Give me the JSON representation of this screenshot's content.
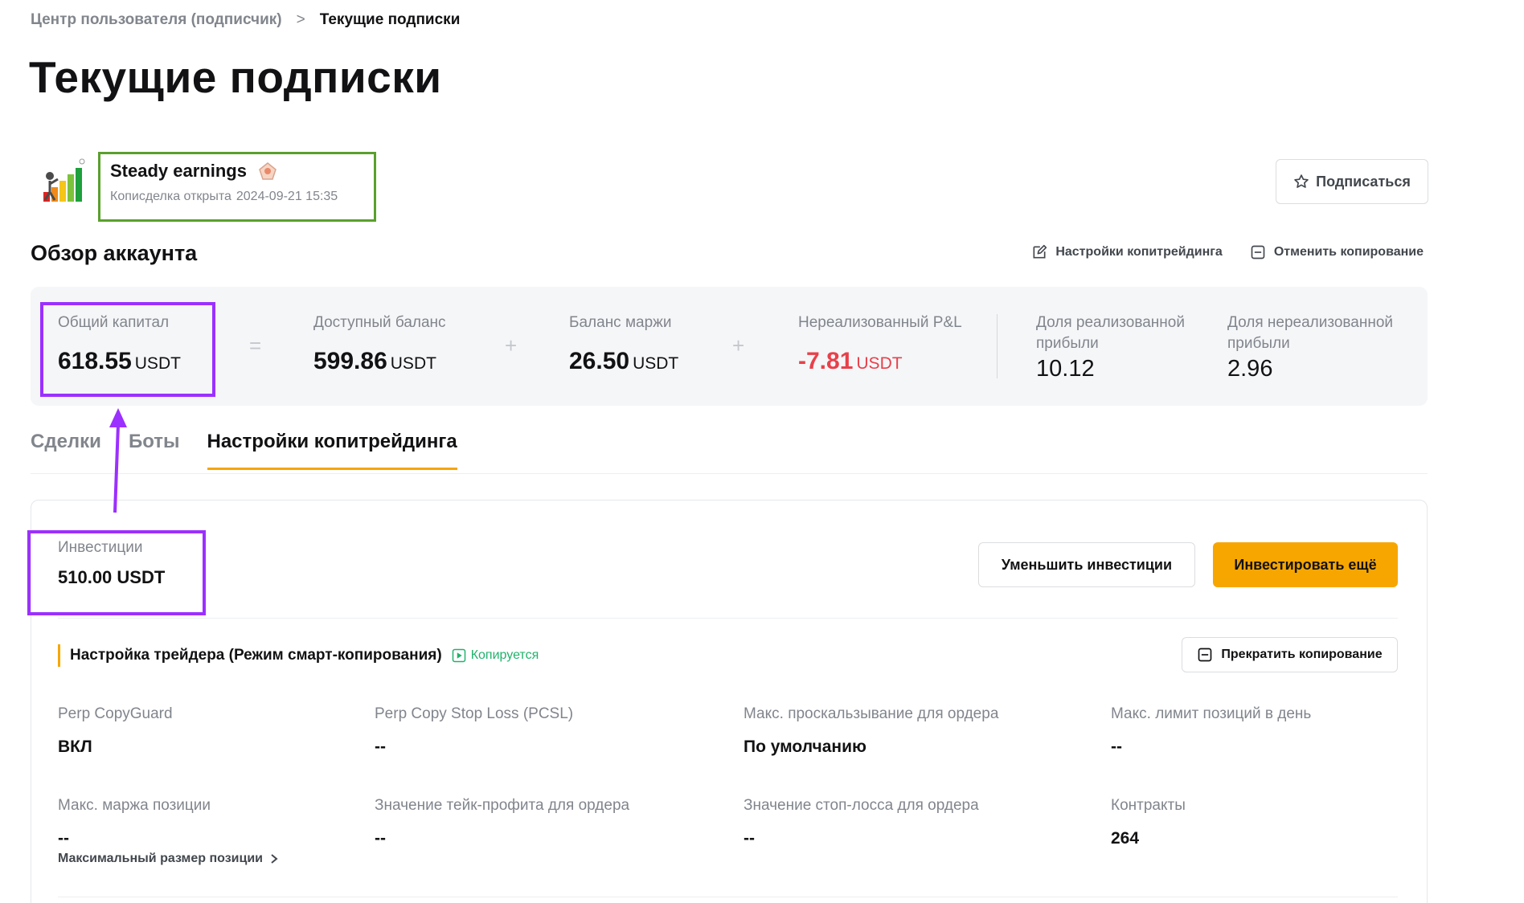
{
  "breadcrumb": {
    "parent": "Центр пользователя (подписчик)",
    "separator": ">",
    "current": "Текущие подписки"
  },
  "page_title": "Текущие подписки",
  "trader": {
    "name": "Steady earnings",
    "opened_label": "Кописделка открыта",
    "opened_at": "2024-09-21 15:35"
  },
  "subscribe_label": "Подписаться",
  "overview": {
    "title": "Обзор аккаунта",
    "settings_link": "Настройки копитрейдинга",
    "cancel_link": "Отменить копирование",
    "operators": {
      "eq": "=",
      "plus1": "+",
      "plus2": "+"
    },
    "metrics": {
      "equity": {
        "label": "Общий капитал",
        "value": "618.55",
        "unit": "USDT"
      },
      "available": {
        "label": "Доступный баланс",
        "value": "599.86",
        "unit": "USDT"
      },
      "margin": {
        "label": "Баланс маржи",
        "value": "26.50",
        "unit": "USDT"
      },
      "unrealized": {
        "label": "Нереализованный P&L",
        "value": "-7.81",
        "unit": "USDT"
      },
      "realized_share": {
        "label": "Доля реализованной прибыли",
        "value": "10.12"
      },
      "unrealized_share": {
        "label": "Доля нереализованной прибыли",
        "value": "2.96"
      }
    }
  },
  "tabs": [
    {
      "label": "Сделки"
    },
    {
      "label": "Боты"
    },
    {
      "label": "Настройки копитрейдинга"
    }
  ],
  "investment": {
    "label": "Инвестиции",
    "value": "510.00 USDT",
    "reduce_label": "Уменьшить инвестиции",
    "invest_more_label": "Инвестировать ещё"
  },
  "trader_settings": {
    "title": "Настройка трейдера (Режим смарт-копирования)",
    "status": "Копируется",
    "stop_label": "Прекратить копирование",
    "fields": [
      {
        "label": "Perp CopyGuard",
        "value": "ВКЛ"
      },
      {
        "label": "Perp Copy Stop Loss (PCSL)",
        "value": "--"
      },
      {
        "label": "Макс. проскальзывание для ордера",
        "value": "По умолчанию"
      },
      {
        "label": "Макс. лимит позиций в день",
        "value": "--"
      },
      {
        "label": "Макс. маржа позиции",
        "value": "--"
      },
      {
        "label": "Значение тейк-профита для ордера",
        "value": "--"
      },
      {
        "label": "Значение стоп-лосса для ордера",
        "value": "--"
      },
      {
        "label": "Контракты",
        "value": "264"
      }
    ],
    "max_size_link": "Максимальный размер позиции"
  },
  "colors": {
    "accent": "#f7a600",
    "negative": "#e8404a",
    "positive": "#20b26c",
    "highlight_green": "#5aa02c",
    "highlight_purple": "#9b30ff"
  }
}
